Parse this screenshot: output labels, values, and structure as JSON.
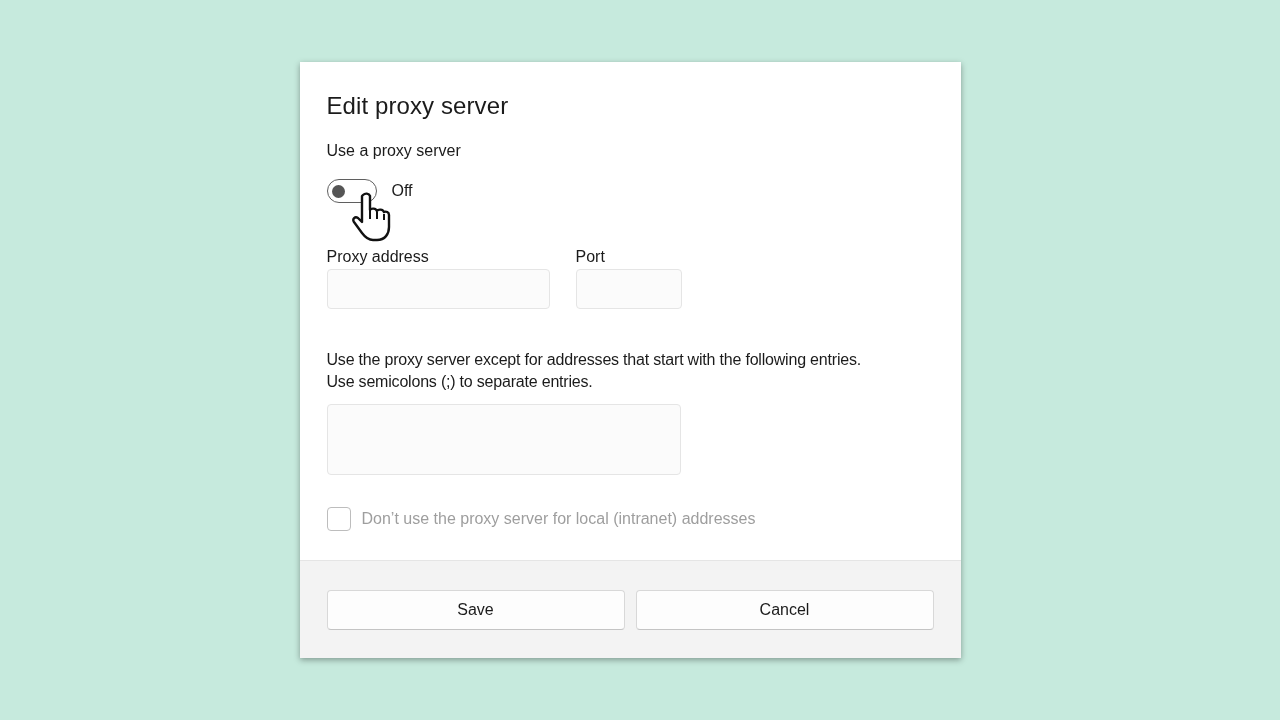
{
  "dialog": {
    "title": "Edit proxy server"
  },
  "proxy_toggle": {
    "label": "Use a proxy server",
    "on": false,
    "state_text": "Off"
  },
  "fields": [
    {
      "label": "Proxy address",
      "kind": "wide"
    },
    {
      "label": "Port",
      "kind": "narrow"
    }
  ],
  "exceptions": {
    "description": "Use the proxy server except for addresses that start with the following entries.\nUse semicolons (;) to separate entries."
  },
  "local_checkbox": {
    "label": "Don’t use the proxy server for local (intranet) addresses",
    "checked": false,
    "disabled": true
  },
  "buttons": [
    {
      "label": "Save"
    },
    {
      "label": "Cancel"
    }
  ]
}
